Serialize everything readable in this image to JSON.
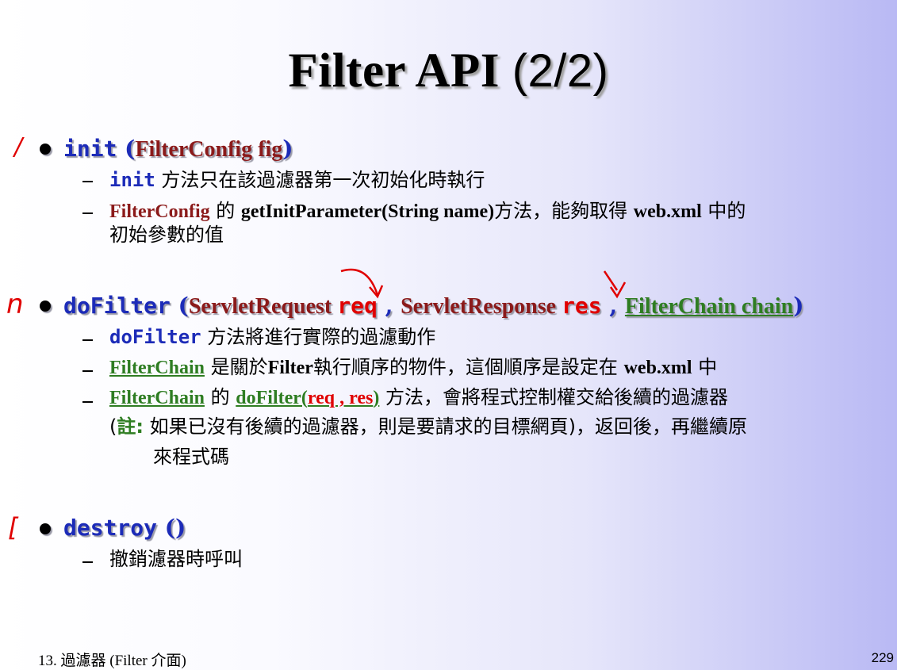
{
  "slide": {
    "title_main": "Filter API ",
    "title_paren": "(2/2)",
    "footer_left": "13. 過濾器 (Filter 介面)",
    "footer_right": "229"
  },
  "annotations": {
    "mark_init": "/",
    "mark_dofilter": "n",
    "mark_destroy": "["
  },
  "init": {
    "name": "init",
    "sig_open": " (",
    "param_type": "FilterConfig",
    "param_name": "  fig",
    "sig_close": ")",
    "sub1_kw": "init",
    "sub1_text": " 方法只在該過濾器第一次初始化時執行",
    "sub2_kw": "FilterConfig",
    "sub2_text1": " 的 ",
    "sub2_method": "getInitParameter(String name)",
    "sub2_text2": "方法，能夠取得 ",
    "sub2_file": "web.xml",
    "sub2_text3": " 中的",
    "sub2_line2": "初始參數的值"
  },
  "dofilter": {
    "name": "doFilter",
    "sig_open": " (",
    "type1": "ServletRequest ",
    "param1": "req",
    "comma1": " , ",
    "type2": "ServletResponse ",
    "param2": "res",
    "comma2": " , ",
    "type3": "FilterChain chain",
    "sig_close": ")",
    "sub1_kw": "doFilter",
    "sub1_text": " 方法將進行實際的過濾動作",
    "sub2_kw": "FilterChain",
    "sub2_text1": " 是關於",
    "sub2_filter": "Filter",
    "sub2_text2": "執行順序的物件，這個順序是設定在 ",
    "sub2_file": "web.xml",
    "sub2_text3": " 中",
    "sub3_kw": "FilterChain",
    "sub3_text1": " 的 ",
    "sub3_method": "doFilter(",
    "sub3_args": "req , res",
    "sub3_close": ")",
    "sub3_text2": " 方法，會將程式控制權交給後續的過濾器",
    "sub3_line2_open": "(",
    "sub3_note": "註:",
    "sub3_line2_text": " 如果已沒有後續的過濾器，則是要請求的目標網頁)，返回後，再繼續原",
    "sub3_line3": "來程式碼"
  },
  "destroy": {
    "name": "destroy",
    "sig": " ()",
    "sub1_text": "撤銷濾器時呼叫"
  },
  "watermark": "",
  "colors": {
    "keyword_blue": "#1c2bb8",
    "type_darkred": "#8b1a1a",
    "param_red": "#e00000",
    "chain_green": "#2e7d22",
    "ink_red": "#e00000"
  }
}
